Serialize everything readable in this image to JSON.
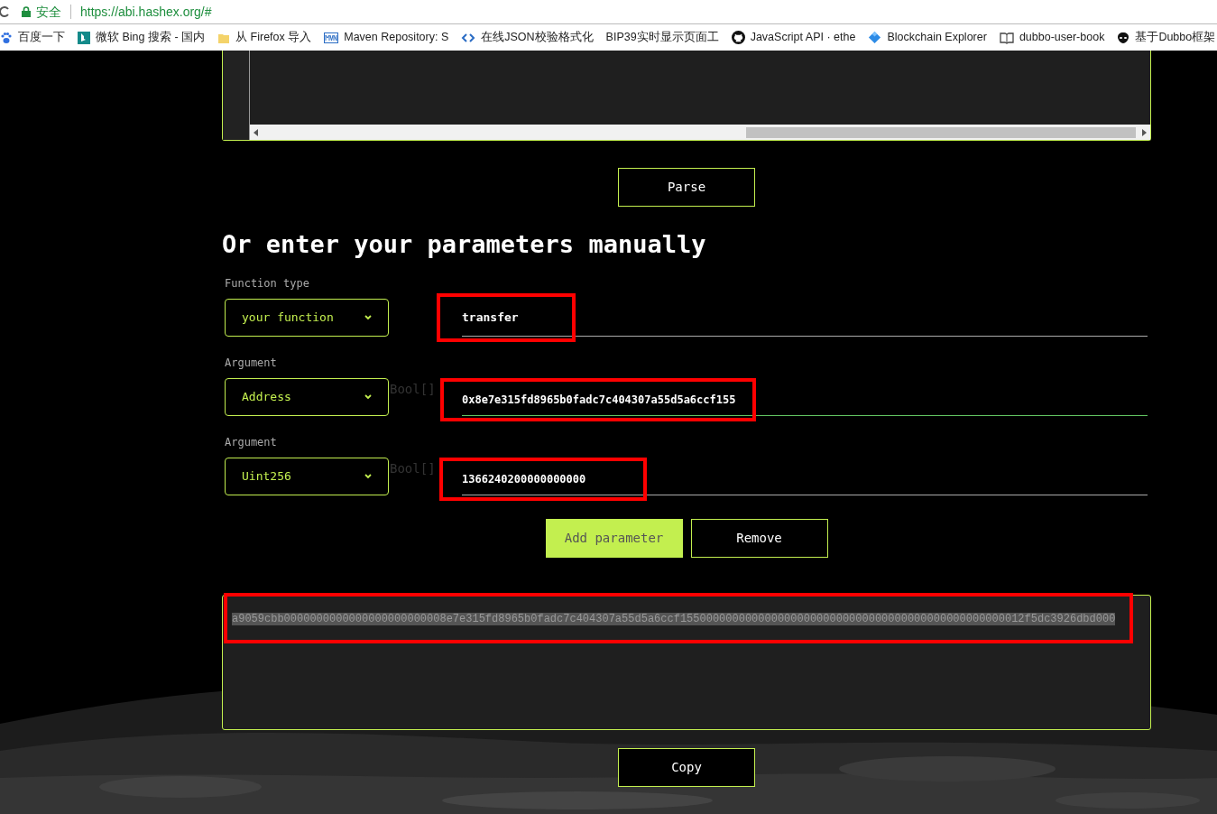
{
  "browser": {
    "security_label": "安全",
    "url": "https://abi.hashex.org/#",
    "bookmarks": [
      {
        "kind": "paw",
        "label": "百度一下"
      },
      {
        "kind": "bing",
        "label": "微软 Bing 搜索 - 国内"
      },
      {
        "kind": "folder",
        "label": "从 Firefox 导入"
      },
      {
        "kind": "mvn",
        "label": "Maven Repository: S"
      },
      {
        "kind": "code",
        "label": "在线JSON校验格式化"
      },
      {
        "kind": "plain",
        "label": "BIP39实时显示页面工"
      },
      {
        "kind": "github",
        "label": "JavaScript API · ethe"
      },
      {
        "kind": "diamond",
        "label": "Blockchain Explorer"
      },
      {
        "kind": "book",
        "label": "dubbo-user-book"
      },
      {
        "kind": "alien",
        "label": "基于Dubbo框架"
      }
    ]
  },
  "parse_button": "Parse",
  "heading": "Or enter your parameters manually",
  "function_type": {
    "label": "Function type",
    "select": "your function",
    "name_value": "transfer",
    "annotated": true
  },
  "arguments": [
    {
      "label": "Argument",
      "type": "Address",
      "ghost": "Bool[]",
      "value": "0x8e7e315fd8965b0fadc7c404307a55d5a6ccf155",
      "focused": true,
      "annotated": true
    },
    {
      "label": "Argument",
      "type": "Uint256",
      "ghost": "Bool[]",
      "value": "1366240200000000000",
      "focused": false,
      "annotated": true
    }
  ],
  "add_button": "Add parameter",
  "remove_button": "Remove",
  "output": {
    "value": "a9059cbb0000000000000000000000008e7e315fd8965b0fadc7c404307a55d5a6ccf15500000000000000000000000000000000000000000000000012f5dc3926dbd000",
    "selected": true,
    "annotated": true
  },
  "copy_button": "Copy"
}
